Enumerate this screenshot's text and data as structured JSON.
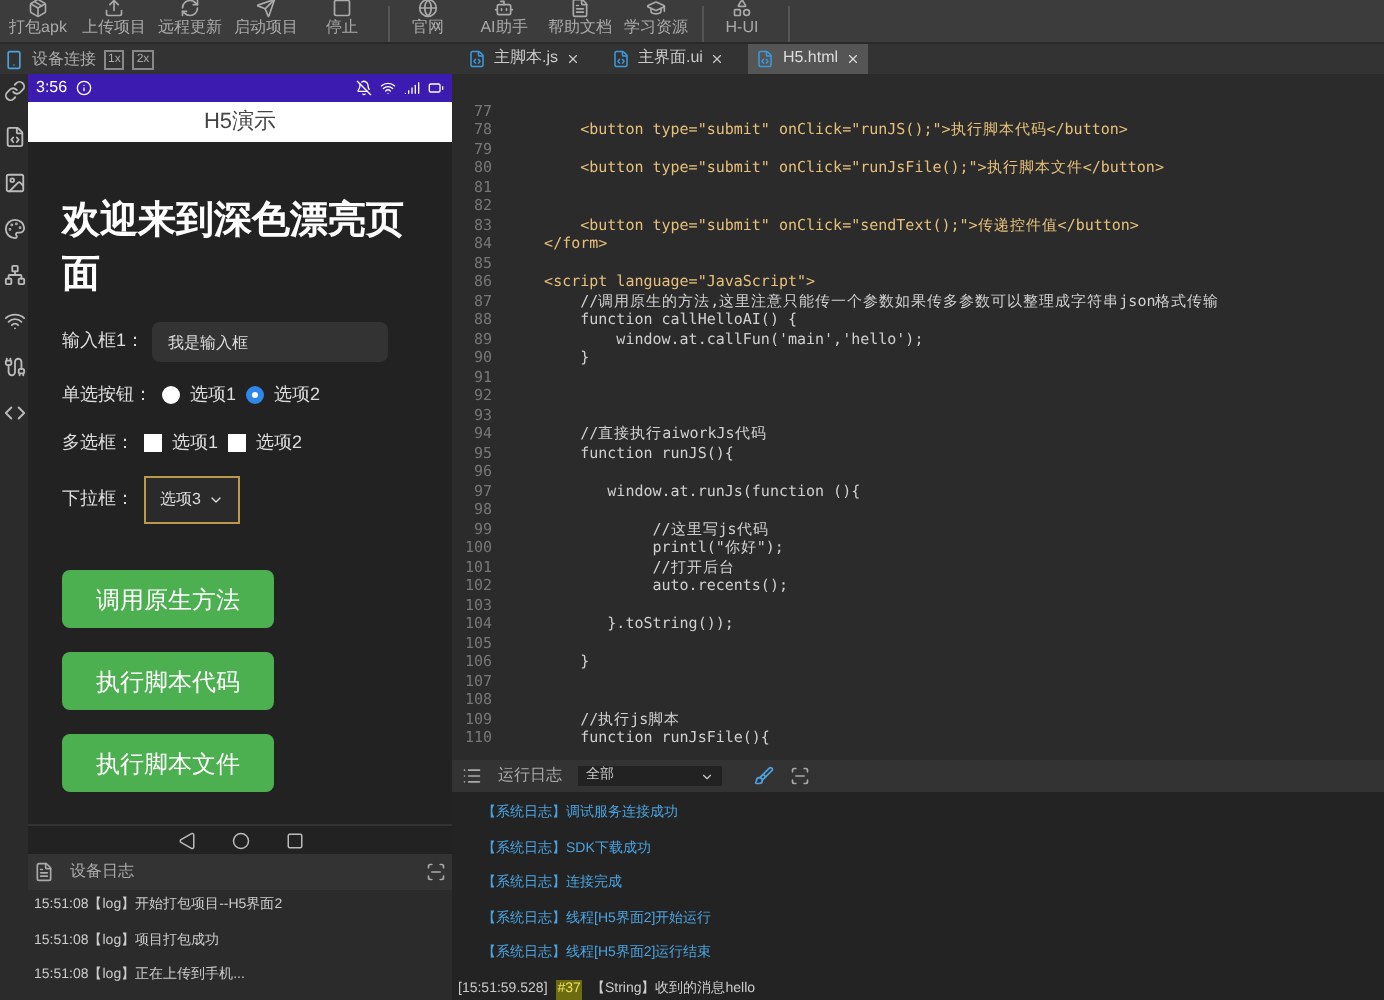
{
  "toolbar": {
    "groups": [
      [
        {
          "label": "打包apk"
        },
        {
          "label": "上传项目"
        },
        {
          "label": "远程更新"
        },
        {
          "label": "启动项目"
        },
        {
          "label": "停止"
        }
      ],
      [
        {
          "label": "官网"
        },
        {
          "label": "AI助手"
        },
        {
          "label": "帮助文档"
        },
        {
          "label": "学习资源"
        }
      ],
      [
        {
          "label": "H-UI"
        }
      ]
    ]
  },
  "device_panel": {
    "title": "设备连接",
    "badges": [
      "1x",
      "2x"
    ]
  },
  "phone": {
    "status_bar": {
      "time": "3:56"
    },
    "title": "H5演示",
    "heading": "欢迎来到深色漂亮页面",
    "input": {
      "label": "输入框1：",
      "value": "我是输入框"
    },
    "radios": {
      "label": "单选按钮：",
      "options": [
        {
          "label": "选项1",
          "selected": false
        },
        {
          "label": "选项2",
          "selected": true
        }
      ]
    },
    "checkboxes": {
      "label": "多选框：",
      "options": [
        {
          "label": "选项1",
          "checked": false
        },
        {
          "label": "选项2",
          "checked": false
        }
      ]
    },
    "select": {
      "label": "下拉框：",
      "value": "选项3"
    },
    "buttons": [
      "调用原生方法",
      "执行脚本代码",
      "执行脚本文件"
    ]
  },
  "device_log": {
    "title": "设备日志",
    "lines": [
      "15:51:08【log】开始打包项目--H5界面2",
      "15:51:08【log】项目打包成功",
      "15:51:08【log】正在上传到手机..."
    ]
  },
  "tabs": [
    {
      "label": "主脚本.js",
      "selected": false
    },
    {
      "label": "主界面.ui",
      "selected": false
    },
    {
      "label": "H5.html",
      "selected": true
    }
  ],
  "code": [
    {
      "num": "77"
    },
    {
      "num": "78",
      "text": "        <button type=\"submit\" onClick=\"runJS();\">执行脚本代码</button>",
      "kind": "tag"
    },
    {
      "num": "79"
    },
    {
      "num": "80",
      "text": "        <button type=\"submit\" onClick=\"runJsFile();\">执行脚本文件</button>",
      "kind": "tag"
    },
    {
      "num": "81"
    },
    {
      "num": "82"
    },
    {
      "num": "83",
      "text": "        <button type=\"submit\" onClick=\"sendText();\">传递控件值</button>",
      "kind": "tag"
    },
    {
      "num": "84",
      "text": "    </form>",
      "kind": "tag"
    },
    {
      "num": "85"
    },
    {
      "num": "86",
      "text": "    <script language=\"JavaScript\">",
      "kind": "tag"
    },
    {
      "num": "87",
      "text": "        //调用原生的方法,这里注意只能传一个参数如果传多参数可以整理成字符串json格式传输",
      "kind": "code"
    },
    {
      "num": "88",
      "text": "        function callHelloAI() {",
      "kind": "code"
    },
    {
      "num": "89",
      "text": "            window.at.callFun('main','hello');",
      "kind": "code"
    },
    {
      "num": "90",
      "text": "        }",
      "kind": "code"
    },
    {
      "num": "91"
    },
    {
      "num": "92"
    },
    {
      "num": "93"
    },
    {
      "num": "94",
      "text": "        //直接执行aiworkJs代码",
      "kind": "code"
    },
    {
      "num": "95",
      "text": "        function runJS(){",
      "kind": "code"
    },
    {
      "num": "96"
    },
    {
      "num": "97",
      "text": "           window.at.runJs(function (){",
      "kind": "code"
    },
    {
      "num": "98"
    },
    {
      "num": "99",
      "text": "                //这里写js代码",
      "kind": "code"
    },
    {
      "num": "100",
      "text": "                printl(\"你好\");",
      "kind": "code"
    },
    {
      "num": "101",
      "text": "                //打开后台",
      "kind": "code"
    },
    {
      "num": "102",
      "text": "                auto.recents();",
      "kind": "code"
    },
    {
      "num": "103"
    },
    {
      "num": "104",
      "text": "           }.toString());",
      "kind": "code"
    },
    {
      "num": "105"
    },
    {
      "num": "106",
      "text": "        }",
      "kind": "code"
    },
    {
      "num": "107"
    },
    {
      "num": "108"
    },
    {
      "num": "109",
      "text": "        //执行js脚本",
      "kind": "code"
    },
    {
      "num": "110",
      "text": "        function runJsFile(){",
      "kind": "code"
    }
  ],
  "run_log": {
    "title": "运行日志",
    "filter": "全部",
    "lines": [
      {
        "kind": "system",
        "text": "【系统日志】调试服务连接成功"
      },
      {
        "kind": "system",
        "text": "【系统日志】SDK下载成功"
      },
      {
        "kind": "system",
        "text": "【系统日志】连接完成"
      },
      {
        "kind": "system",
        "text": "【系统日志】线程[H5界面2]开始运行"
      },
      {
        "kind": "system",
        "text": "【系统日志】线程[H5界面2]运行结束"
      },
      {
        "kind": "message",
        "time": "[15:51:59.528]",
        "tag": "#37",
        "text": "【String】收到的消息hello"
      }
    ]
  }
}
